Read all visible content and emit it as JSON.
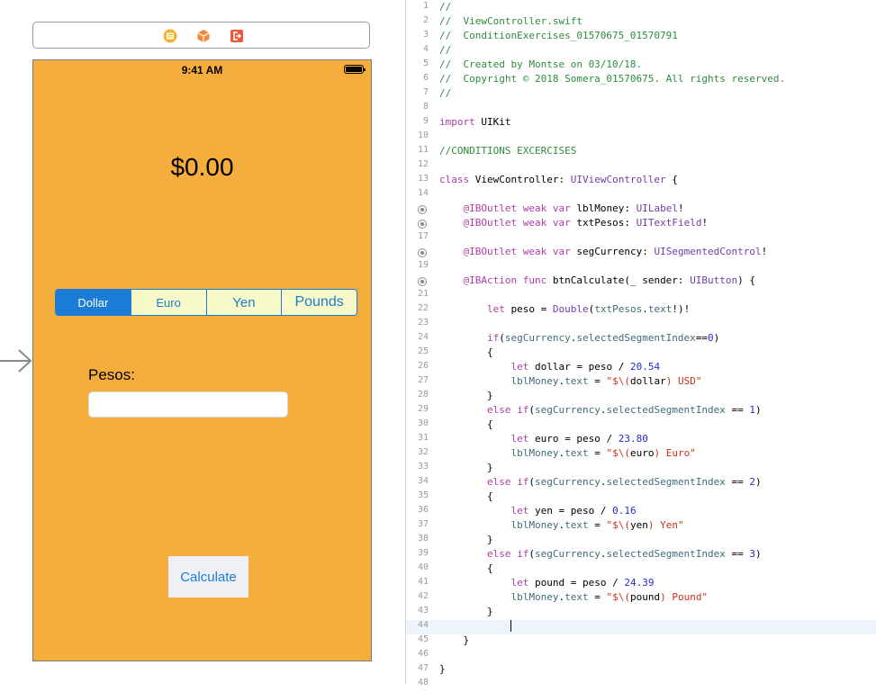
{
  "storyboard": {
    "dock_icons": [
      "view-controller-icon",
      "first-responder-icon",
      "exit-icon"
    ],
    "status_bar": {
      "time": "9:41 AM"
    },
    "money_label": "$0.00",
    "segmented_control": {
      "segments": [
        "Dollar",
        "Euro",
        "Yen",
        "Pounds"
      ],
      "selected_index": 0
    },
    "pesos_label": "Pesos:",
    "pesos_field": {
      "value": "",
      "placeholder": ""
    },
    "calculate_button": "Calculate",
    "colors": {
      "background": "#f5ad3e",
      "tint": "#1b7cd6",
      "segment_bg": "#f7f9c9",
      "button_bg": "#eef0f6"
    }
  },
  "editor": {
    "current_line": 44,
    "lines": [
      {
        "n": "1",
        "text": "//"
      },
      {
        "n": "2",
        "text": "//  ViewController.swift"
      },
      {
        "n": "3",
        "text": "//  ConditionExercises_01570675_01570791"
      },
      {
        "n": "4",
        "text": "//"
      },
      {
        "n": "5",
        "text": "//  Created by Montse on 03/10/18."
      },
      {
        "n": "6",
        "text": "//  Copyright © 2018 Somera_01570675. All rights reserved."
      },
      {
        "n": "7",
        "text": "//"
      },
      {
        "n": "8",
        "text": ""
      },
      {
        "n": "9",
        "text": "import UIKit"
      },
      {
        "n": "10",
        "text": ""
      },
      {
        "n": "11",
        "text": "//CONDITIONS EXCERCISES"
      },
      {
        "n": "12",
        "text": ""
      },
      {
        "n": "13",
        "text": "class ViewController: UIViewController {"
      },
      {
        "n": "14",
        "text": ""
      },
      {
        "n": "",
        "text": "    @IBOutlet weak var lblMoney: UILabel!",
        "mark": true
      },
      {
        "n": "",
        "text": "    @IBOutlet weak var txtPesos: UITextField!",
        "mark": true
      },
      {
        "n": "17",
        "text": ""
      },
      {
        "n": "",
        "text": "    @IBOutlet weak var segCurrency: UISegmentedControl!",
        "mark": true
      },
      {
        "n": "19",
        "text": ""
      },
      {
        "n": "",
        "text": "    @IBAction func btnCalculate(_ sender: UIButton) {",
        "mark": true
      },
      {
        "n": "21",
        "text": ""
      },
      {
        "n": "22",
        "text": "        let peso = Double(txtPesos.text!)!"
      },
      {
        "n": "23",
        "text": ""
      },
      {
        "n": "24",
        "text": "        if(segCurrency.selectedSegmentIndex==0)"
      },
      {
        "n": "25",
        "text": "        {"
      },
      {
        "n": "26",
        "text": "            let dollar = peso / 20.54"
      },
      {
        "n": "27",
        "text": "            lblMoney.text = \"$\\(dollar) USD\""
      },
      {
        "n": "28",
        "text": "        }"
      },
      {
        "n": "29",
        "text": "        else if(segCurrency.selectedSegmentIndex == 1)"
      },
      {
        "n": "30",
        "text": "        {"
      },
      {
        "n": "31",
        "text": "            let euro = peso / 23.80"
      },
      {
        "n": "32",
        "text": "            lblMoney.text = \"$\\(euro) Euro\""
      },
      {
        "n": "33",
        "text": "        }"
      },
      {
        "n": "34",
        "text": "        else if(segCurrency.selectedSegmentIndex == 2)"
      },
      {
        "n": "35",
        "text": "        {"
      },
      {
        "n": "36",
        "text": "            let yen = peso / 0.16"
      },
      {
        "n": "37",
        "text": "            lblMoney.text = \"$\\(yen) Yen\""
      },
      {
        "n": "38",
        "text": "        }"
      },
      {
        "n": "39",
        "text": "        else if(segCurrency.selectedSegmentIndex == 3)"
      },
      {
        "n": "40",
        "text": "        {"
      },
      {
        "n": "41",
        "text": "            let pound = peso / 24.39"
      },
      {
        "n": "42",
        "text": "            lblMoney.text = \"$\\(pound) Pound\""
      },
      {
        "n": "43",
        "text": "        }"
      },
      {
        "n": "44",
        "text": "            "
      },
      {
        "n": "45",
        "text": "    }"
      },
      {
        "n": "46",
        "text": ""
      },
      {
        "n": "47",
        "text": "}"
      },
      {
        "n": "48",
        "text": ""
      }
    ]
  }
}
